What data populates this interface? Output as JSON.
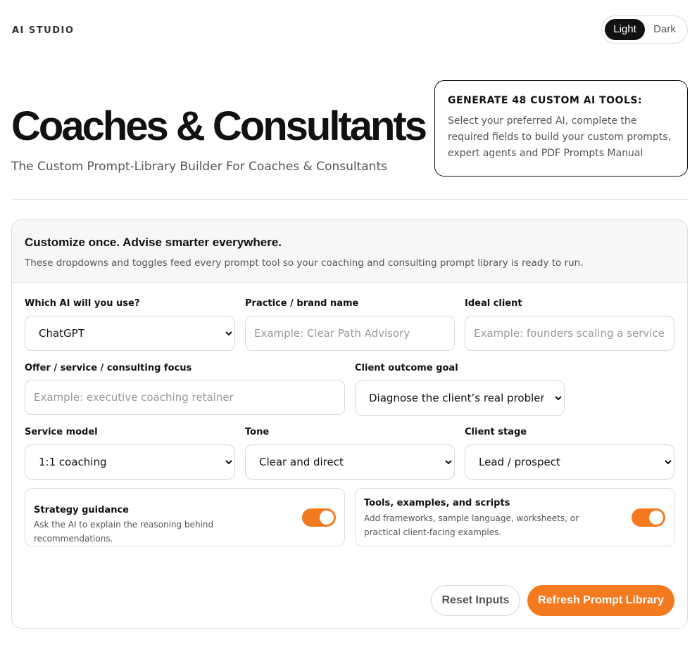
{
  "header": {
    "brand": "AI STUDIO",
    "theme_options": [
      "Light",
      "Dark"
    ],
    "active_theme": "Light"
  },
  "hero": {
    "title": "Coaches & Consultants",
    "subtitle": "The Custom Prompt-Library Builder For Coaches & Consultants"
  },
  "promo": {
    "title": "GENERATE 48 CUSTOM AI TOOLS:",
    "body": "Select your preferred AI, complete the required fields to build your custom prompts, expert agents and PDF Prompts Manual"
  },
  "form": {
    "title": "Customize once. Advise smarter everywhere.",
    "description": "These dropdowns and toggles feed every prompt tool so your coaching and consulting prompt library is ready to run.",
    "ai": {
      "label": "Which AI will you use?",
      "value": "ChatGPT"
    },
    "brand_name": {
      "label": "Practice / brand name",
      "placeholder": "Example: Clear Path Advisory"
    },
    "ideal_client": {
      "label": "Ideal client",
      "placeholder": "Example: founders scaling a service business"
    },
    "offer": {
      "label": "Offer / service / consulting focus",
      "placeholder": "Example: executive coaching retainer"
    },
    "outcome": {
      "label": "Client outcome goal",
      "value": "Diagnose the client’s real problem"
    },
    "service_model": {
      "label": "Service model",
      "value": "1:1 coaching"
    },
    "tone": {
      "label": "Tone",
      "value": "Clear and direct"
    },
    "client_stage": {
      "label": "Client stage",
      "value": "Lead / prospect"
    },
    "toggle_strategy": {
      "title": "Strategy guidance",
      "description": "Ask the AI to explain the reasoning behind recommendations.",
      "on": true
    },
    "toggle_tools": {
      "title": "Tools, examples, and scripts",
      "description": "Add frameworks, sample language, worksheets, or practical client-facing examples.",
      "on": true
    },
    "reset_label": "Reset Inputs",
    "refresh_label": "Refresh Prompt Library"
  },
  "colors": {
    "accent": "#f47a1f",
    "dark": "#111111",
    "muted": "#555555"
  }
}
